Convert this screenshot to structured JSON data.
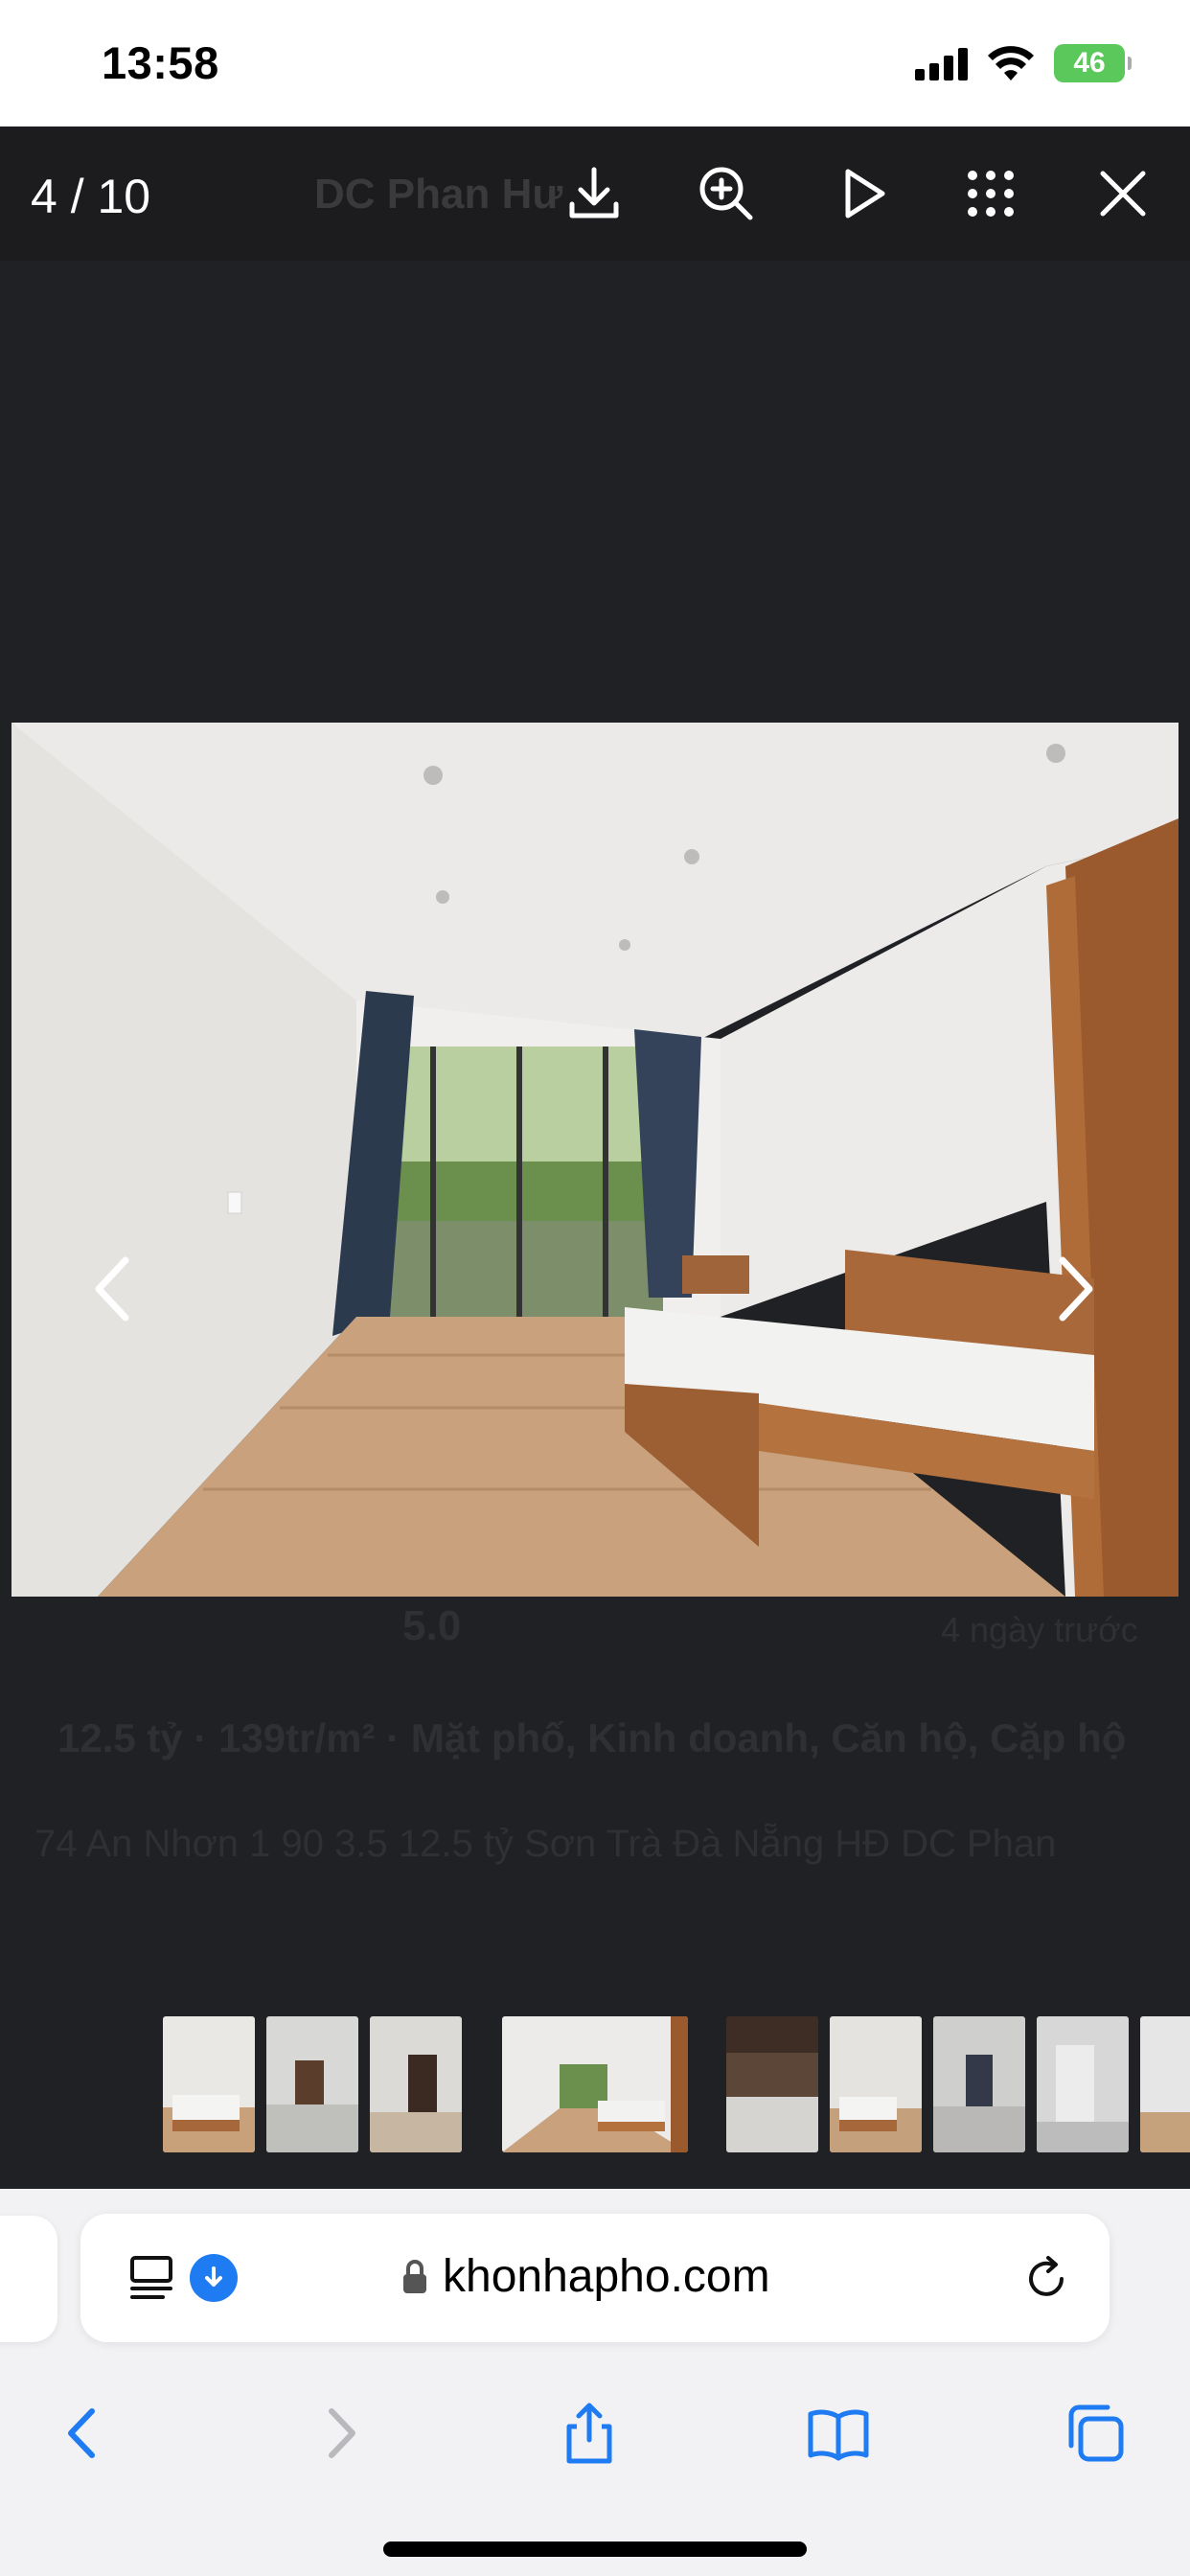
{
  "status_bar": {
    "time": "13:58",
    "battery": "46"
  },
  "lightbox": {
    "counter": "4 / 10",
    "title_under_toolbar": "DC Phan Hư",
    "toolbar_icons": [
      "download-icon",
      "zoom-in-icon",
      "play-icon",
      "grid-icon",
      "close-icon"
    ],
    "background_page": {
      "rating": "5.0",
      "time_ago": "4 ngày trước",
      "price_line": "12.5 tỷ  ·  139tr/m²  ·  Mặt phố, Kinh doanh, Căn hộ, Cặp hộ",
      "listing_title": "74 An Nhơn 1 90 3.5 12.5 tỷ Sơn Trà Đà Nẵng HĐ DC Phan"
    },
    "current_photo": "bedroom-photo",
    "thumbnail_count": 10,
    "active_thumbnail": 4
  },
  "safari": {
    "url": "khonhapho.com",
    "nav_icons": [
      "back-icon",
      "forward-icon",
      "share-icon",
      "bookmarks-icon",
      "tabs-icon"
    ]
  },
  "colors": {
    "lightbox_bg": "#202124",
    "accent_blue": "#1f7bf2",
    "battery_green": "#5ac85a"
  }
}
